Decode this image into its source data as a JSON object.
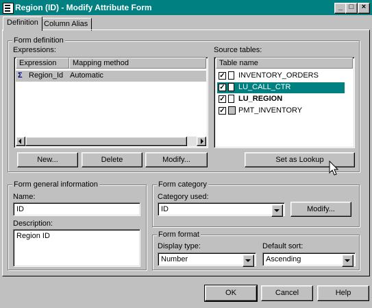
{
  "window": {
    "title": "Region (ID) - Modify Attribute Form"
  },
  "tabs": [
    {
      "label": "Definition"
    },
    {
      "label": "Column Alias"
    }
  ],
  "form_definition": {
    "label": "Form definition",
    "expressions_label": "Expressions:",
    "columns": [
      "Expression",
      "Mapping method"
    ],
    "rows": [
      {
        "expression": "Region_Id",
        "mapping": "Automatic"
      }
    ],
    "buttons": {
      "new": "New...",
      "delete": "Delete",
      "modify": "Modify..."
    }
  },
  "source_tables": {
    "label": "Source tables:",
    "column": "Table name",
    "items": [
      {
        "name": "INVENTORY_ORDERS",
        "checked": true
      },
      {
        "name": "LU_CALL_CTR",
        "checked": true
      },
      {
        "name": "LU_REGION",
        "checked": true
      },
      {
        "name": "PMT_INVENTORY",
        "checked": true
      }
    ],
    "lookup_button": "Set as Lookup"
  },
  "general": {
    "label": "Form general information",
    "name_label": "Name:",
    "name_value": "ID",
    "desc_label": "Description:",
    "desc_value": "Region ID"
  },
  "category": {
    "label": "Form category",
    "used_label": "Category used:",
    "used_value": "ID",
    "modify": "Modify..."
  },
  "format": {
    "label": "Form format",
    "display_label": "Display type:",
    "display_value": "Number",
    "sort_label": "Default sort:",
    "sort_value": "Ascending"
  },
  "footer": {
    "ok": "OK",
    "cancel": "Cancel",
    "help": "Help"
  },
  "colors": {
    "title": "#008080",
    "selection": "#008080",
    "face": "#c0c0c0"
  }
}
